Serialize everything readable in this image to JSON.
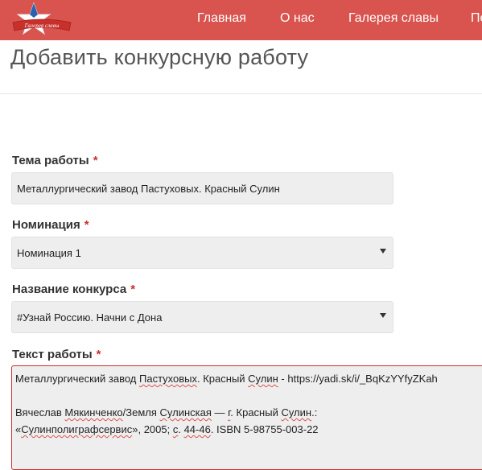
{
  "header": {
    "logo_text": "Галерея славы",
    "nav": [
      "Главная",
      "О нас",
      "Галерея славы",
      "По"
    ]
  },
  "page": {
    "title": "Добавить конкурсную работу"
  },
  "form": {
    "required_mark": "*",
    "topic": {
      "label": "Тема работы",
      "value": "Металлургический завод Пастуховых. Красный Сулин"
    },
    "nomination": {
      "label": "Номинация",
      "selected": "Номинация 1"
    },
    "contest": {
      "label": "Название конкурса",
      "selected": "#Узнай Россию. Начни с Дона"
    },
    "text": {
      "label": "Текст работы",
      "line1_a": "Металлургический завод ",
      "line1_b": "Пастуховых",
      "line1_c": ". Красный ",
      "line1_d": "Сулин",
      "line1_e": " - https://yadi.sk/i/_BqKzYYfyZKah",
      "line2_a": "Вячеслав ",
      "line2_b": "Мякинченко",
      "line2_c": "/Земля ",
      "line2_d": "Сулинская",
      "line2_e": "  — ",
      "line2_f": "г",
      "line2_g": ". Красный ",
      "line2_h": "Сулин",
      "line2_i": ".:",
      "line3_a": " «",
      "line3_b": "Сулинполиграфсервис",
      "line3_c": "», 2005; ",
      "line3_d": "с",
      "line3_e": ".  ",
      "line3_f": "44-46",
      "line3_g": ". ISBN 5-98755-003-22"
    }
  }
}
